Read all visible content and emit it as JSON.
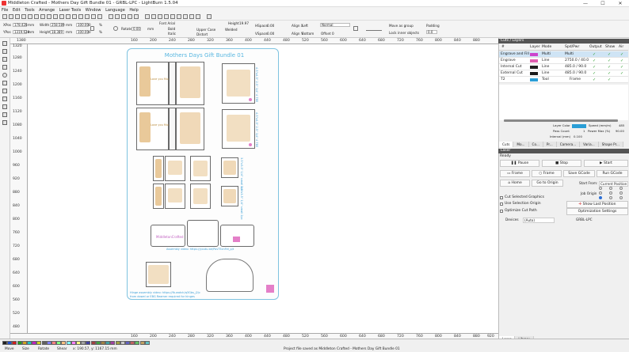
{
  "window": {
    "title": "Middleton Crafted - Mothers Day Gift Bundle 01 - GRBL-LPC - LightBurn 1.5.04",
    "minimize": "—",
    "maximize": "☐",
    "close": "✕"
  },
  "menu": [
    "File",
    "Edit",
    "Tools",
    "Arrange",
    "Laser Tools",
    "Window",
    "Language",
    "Help"
  ],
  "numeric": {
    "xpos_label": "XPos",
    "xpos_value": "178.428",
    "xpos_unit": "mm",
    "ypos_label": "YPos",
    "ypos_value": "1319.628",
    "ypos_unit": "mm",
    "width_label": "Width",
    "width_value": "258.589",
    "height_label": "Height",
    "height_value": "18.389",
    "w_unit": "mm",
    "w_pct": "100.000",
    "h_unit": "mm",
    "h_pct": "100.000",
    "pct": "%",
    "rotate_label": "Rotate",
    "rotate_value": "0.00",
    "unit_toggle": "mm",
    "font_label": "Font Arial",
    "height2_label": "Height",
    "height2_value": "19.97",
    "hspace_label": "HSpace",
    "hspace_value": "0.00",
    "vspace_label": "VSpace",
    "vspace_value": "0.00",
    "align_x_label": "Align X",
    "align_x_value": "Left",
    "align_y_label": "Align Y",
    "align_y_value": "Bottom",
    "normal_value": "Normal",
    "offset_label": "Offset",
    "offset_value": "0",
    "bold": "Bold",
    "italic": "Italic",
    "upper": "Upper Case",
    "welded": "Welded",
    "distort": "Distort",
    "move_group": "Move as group",
    "lock_inner": "Lock inner objects",
    "padding_label": "Padding",
    "padding_value": "0.0"
  },
  "rulers": {
    "top": [
      "1380",
      "160",
      "200",
      "240",
      "280",
      "320",
      "360",
      "400",
      "440",
      "480",
      "520",
      "560",
      "600",
      "640",
      "680",
      "720",
      "760",
      "800",
      "840",
      "880",
      "920",
      "960",
      "1000",
      "1040",
      "1080"
    ],
    "left": [
      "1320",
      "1280",
      "1240",
      "1200",
      "1160",
      "1120",
      "1080",
      "1040",
      "1000",
      "960",
      "920",
      "880",
      "840",
      "800",
      "760",
      "720",
      "680",
      "640",
      "600",
      "560",
      "520",
      "480"
    ],
    "bottom": [
      "160",
      "200",
      "240",
      "280",
      "320",
      "360",
      "400",
      "440",
      "480",
      "520",
      "560",
      "600",
      "640",
      "680",
      "720",
      "760",
      "800",
      "840",
      "880",
      "920",
      "960",
      "1000",
      "1040",
      "1080"
    ]
  },
  "design": {
    "project_title": "Mothers Days Gift Bundle 01",
    "card_text": "Love you Mum",
    "side_text": "4.5\"x4.5\" 2.5\" 1/4\" 4 TEE",
    "side_text2": "4.5\"x4.5\" 2.5\" 1/4\" 4 TEE",
    "small_text": "3.5\"x3.5\" 1/4\" small 2pc",
    "assembly1": "Assembly video: https://youtu.be/PovT5cnFeI_p/t",
    "assembly2": "Hinge assembly video: https://fb.watch/q3Gbs_j2/c",
    "assembly2b": "from dowel or EBG Reamer required for hinges",
    "brand": "MiddletonCrafted",
    "piece_text": "Love you Mum"
  },
  "layers": {
    "panel_title": "Cuts / Layers",
    "columns": [
      "#",
      "Layer",
      "Mode",
      "Spd/Pwr",
      "Output",
      "Show",
      "Air"
    ],
    "rows": [
      {
        "num": "Engrave and Fill",
        "mode": "Multi",
        "spdpwr": "Multi",
        "color": "#cc44cc",
        "sel": true
      },
      {
        "num": "Engrave",
        "mode": "Line",
        "spdpwr": "2750.0 / 40.0",
        "color": "#e060b0",
        "sel": false
      },
      {
        "num": "Internal Cut",
        "mode": "Line",
        "spdpwr": "485.0 / 90.0",
        "color": "#202020",
        "sel": false
      },
      {
        "num": "External Cut",
        "mode": "Line",
        "spdpwr": "485.0 / 90.0",
        "color": "#1a1a1a",
        "sel": false
      },
      {
        "num": "T2",
        "mode": "Tool",
        "spdpwr": "Frame",
        "color": "#2a9ed6",
        "sel": false
      }
    ],
    "layer_color_label": "Layer Color",
    "speed_label": "Speed (mm/m)",
    "speed_value": "485",
    "pass_label": "Pass Count",
    "pass_value": "1",
    "power_label": "Power Max (%)",
    "power_value": "90.00",
    "interval_label": "Interval (mm)",
    "interval_value": "0.100",
    "tabs": [
      "Cuts",
      "Mo...",
      "Co...",
      "Pr...",
      "Camera...",
      "Varia...",
      "Shape Pr..."
    ]
  },
  "laser": {
    "panel_title": "Laser",
    "status": "Ready",
    "pause": "Pause",
    "stop": "Stop",
    "start": "Start",
    "frame1": "Frame",
    "frame2": "Frame",
    "save_gcode": "Save GCode",
    "run_gcode": "Run GCode",
    "home": "Home",
    "go_origin": "Go to Origin",
    "start_from_label": "Start From:",
    "start_from_value": "Current Position",
    "job_origin": "Job Origin",
    "cut_selected": "Cut Selected Graphics",
    "use_selection": "Use Selection Origin",
    "show_last": "Show Last Position",
    "optimize_path": "Optimize Cut Path",
    "optimization_settings": "Optimization Settings",
    "devices_label": "Devices",
    "devices_value": "(Auto)",
    "device_name": "GRBL-LPC",
    "tabs": [
      "Laser",
      "Library"
    ]
  },
  "status": {
    "move": "Move",
    "size": "Size",
    "rotate": "Rotate",
    "shear": "Shear",
    "coords": "x: 190.57, y: 1167.15 mm",
    "message": "Project file saved as Middleton Crafted - Mothers Day Gift Bundle 01"
  },
  "palette": [
    "#202020",
    "#2050d0",
    "#d02020",
    "#20a020",
    "#d0a020",
    "#20c0c0",
    "#c020c0",
    "#d0d020",
    "#606060",
    "#8080ff",
    "#ff8080",
    "#80ff80",
    "#ffc080",
    "#80ffff",
    "#ff80ff",
    "#ffff80",
    "#a0a0a0",
    "#4040a0",
    "#a04040",
    "#40a040",
    "#a08040",
    "#40a0a0",
    "#a040a0",
    "#a0a040",
    "#c8c8c8",
    "#6060c0",
    "#c06060",
    "#60c060",
    "#c0a060",
    "#60c0c0"
  ],
  "palette_labels": [
    "00",
    "01",
    "02",
    "03",
    "04",
    "05",
    "06",
    "07",
    "08",
    "09",
    "10",
    "11",
    "12",
    "13",
    "14",
    "15",
    "16",
    "17",
    "18",
    "19",
    "20",
    "21",
    "22",
    "23",
    "24",
    "25",
    "26",
    "27",
    "28",
    "29"
  ]
}
